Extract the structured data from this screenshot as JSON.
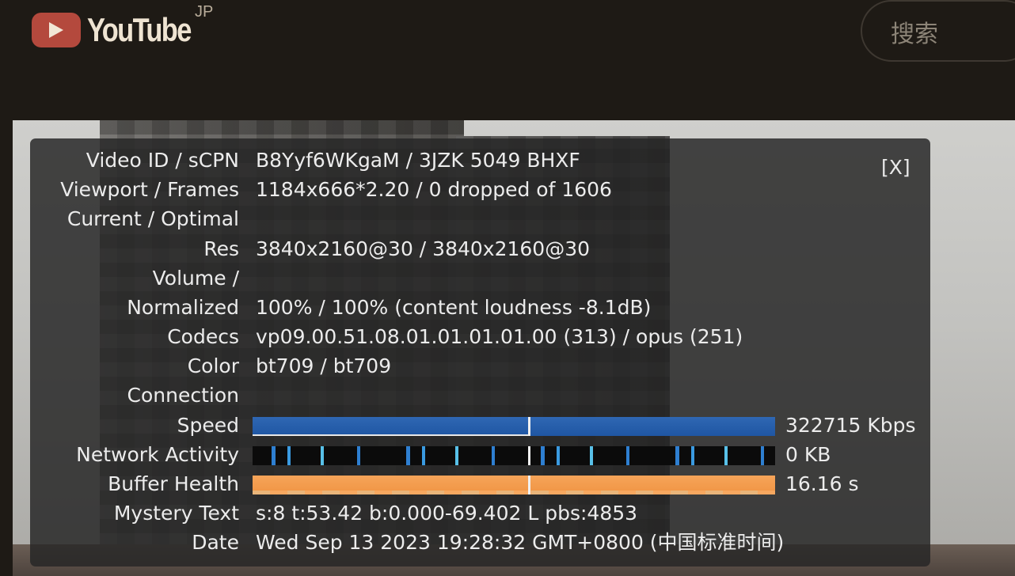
{
  "header": {
    "logo_text": "YouTube",
    "logo_region": "JP",
    "search_placeholder": "搜索"
  },
  "stats": {
    "close_label": "[X]",
    "rows": [
      {
        "label": "Video ID / sCPN",
        "value": "B8Yyf6WKgaM / 3JZK 5049 BHXF"
      },
      {
        "label": "Viewport / Frames",
        "value": "1184x666*2.20 / 0 dropped of 1606"
      },
      {
        "label": "Current / Optimal",
        "value": ""
      },
      {
        "label": "Res",
        "value": "3840x2160@30 / 3840x2160@30"
      },
      {
        "label": "Volume /",
        "value": ""
      },
      {
        "label": "Normalized",
        "value": "100% / 100% (content loudness -8.1dB)"
      },
      {
        "label": "Codecs",
        "value": "vp09.00.51.08.01.01.01.01.00 (313) / opus (251)"
      },
      {
        "label": "Color",
        "value": "bt709 / bt709"
      },
      {
        "label": "Connection",
        "value": ""
      },
      {
        "label": "Speed",
        "value": "322715 Kbps"
      },
      {
        "label": "Network Activity",
        "value": "0 KB"
      },
      {
        "label": "Buffer Health",
        "value": "16.16 s"
      },
      {
        "label": "Mystery Text",
        "value": "s:8 t:53.42 b:0.000-69.402 L pbs:4853"
      },
      {
        "label": "Date",
        "value": "Wed Sep 13 2023 19:28:32 GMT+0800 (中国标准时间)"
      }
    ]
  },
  "colors": {
    "speed_bar": "#1f56a3",
    "network_activity": "#2e7fd1",
    "buffer_health": "#f09443",
    "logo_red": "#b4493d"
  }
}
